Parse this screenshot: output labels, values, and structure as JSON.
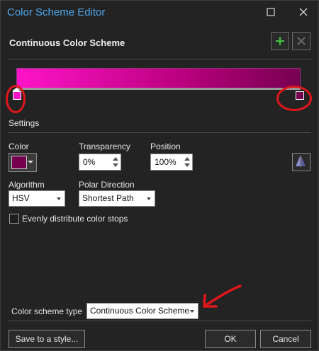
{
  "window": {
    "title": "Color Scheme Editor",
    "maximize_icon": "maximize-icon",
    "close_icon": "close-icon"
  },
  "header": {
    "title": "Continuous Color Scheme",
    "add_icon": "plus-icon",
    "remove_icon": "x-icon"
  },
  "gradient": {
    "start_color": "#ff14c8",
    "end_color": "#760050",
    "stops": [
      {
        "position_percent": 0,
        "color": "#ff14c8",
        "selected": true
      },
      {
        "position_percent": 100,
        "color": "#760050",
        "selected": false
      }
    ]
  },
  "settings": {
    "section_label": "Settings",
    "color_label": "Color",
    "color_value": "#760050",
    "transparency_label": "Transparency",
    "transparency_value": "0%",
    "position_label": "Position",
    "position_value": "100%",
    "flip_icon": "flip-icon",
    "algorithm_label": "Algorithm",
    "algorithm_value": "HSV",
    "polar_label": "Polar Direction",
    "polar_value": "Shortest Path",
    "evenly_label": "Evenly distribute color stops",
    "evenly_checked": false
  },
  "footer": {
    "scheme_type_label": "Color scheme type",
    "scheme_type_value": "Continuous Color Scheme",
    "save_label": "Save to a style...",
    "ok_label": "OK",
    "cancel_label": "Cancel"
  },
  "annotations": {
    "color": "#e0161c"
  }
}
